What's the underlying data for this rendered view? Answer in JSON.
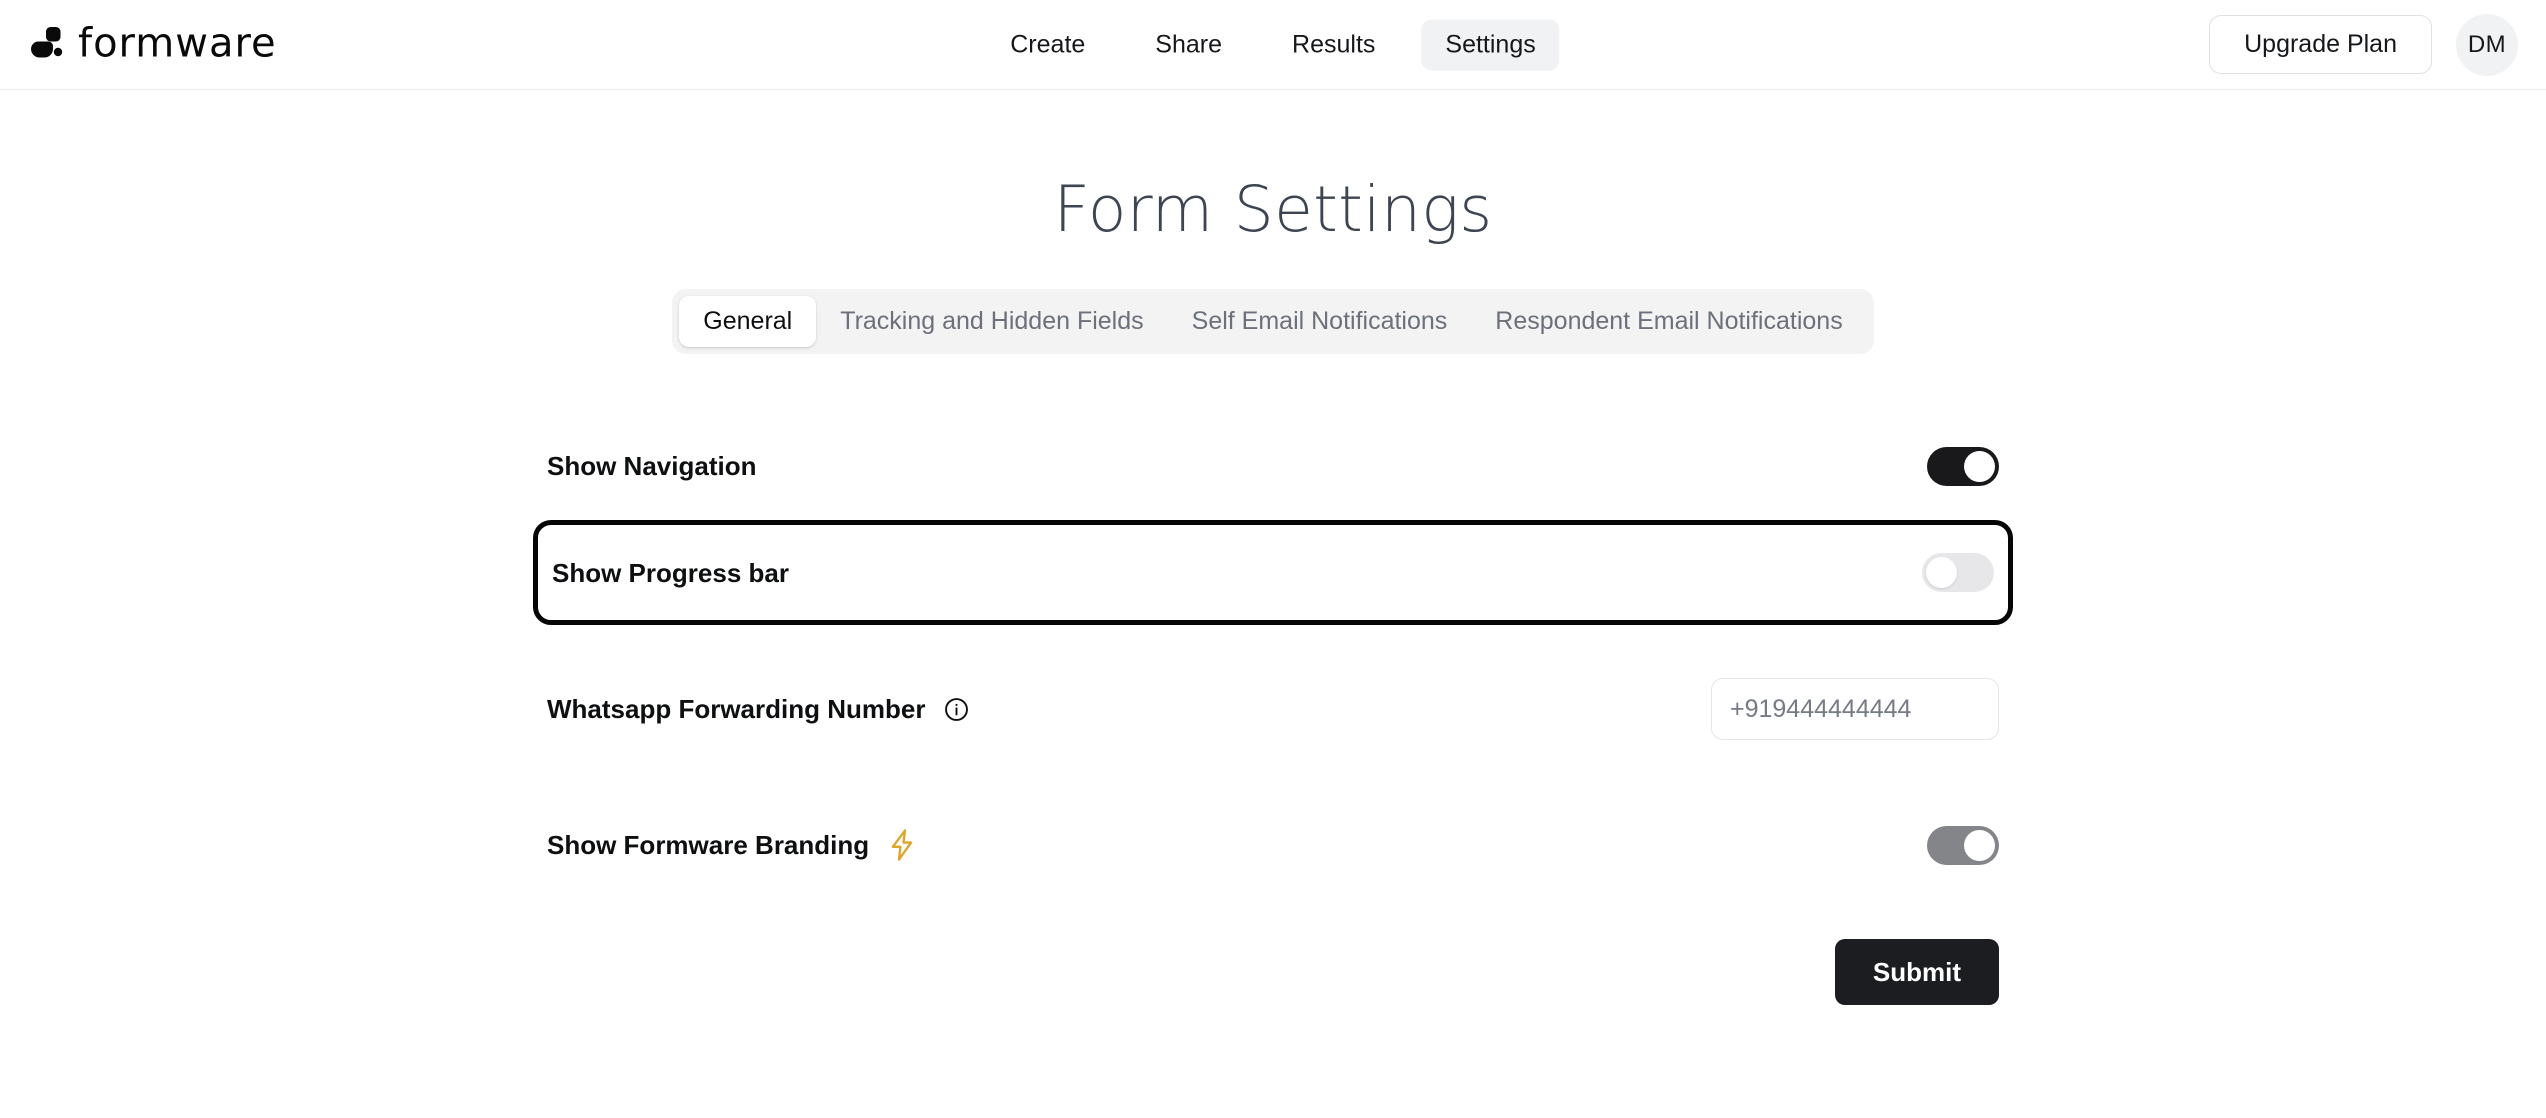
{
  "header": {
    "brand": {
      "word": "formware",
      "mark_icon": "formware-logo-mark"
    },
    "nav": [
      {
        "label": "Create",
        "active": false
      },
      {
        "label": "Share",
        "active": false
      },
      {
        "label": "Results",
        "active": false
      },
      {
        "label": "Settings",
        "active": true
      }
    ],
    "upgrade_label": "Upgrade Plan",
    "avatar_initials": "DM"
  },
  "main": {
    "title": "Form Settings",
    "tabs": [
      {
        "label": "General",
        "active": true
      },
      {
        "label": "Tracking and Hidden Fields",
        "active": false
      },
      {
        "label": "Self Email Notifications",
        "active": false
      },
      {
        "label": "Respondent Email Notifications",
        "active": false
      }
    ],
    "settings": {
      "show_navigation": {
        "label": "Show Navigation",
        "state": "on"
      },
      "show_progress_bar": {
        "label": "Show Progress bar",
        "state": "off",
        "highlighted": true
      },
      "whatsapp": {
        "label": "Whatsapp Forwarding Number",
        "info_icon": "info-circle-icon",
        "value": "",
        "placeholder": "+919444444444"
      },
      "branding": {
        "label": "Show Formware Branding",
        "bolt_icon": "lightning-bolt-icon",
        "state": "on-muted"
      }
    },
    "submit_label": "Submit"
  },
  "colors": {
    "accent_black": "#19191c",
    "toggle_off_track": "#e7e7e9",
    "toggle_muted_track": "#848588",
    "bolt_amber": "#e0a526",
    "title_slate": "#3d4552",
    "tabbar_bg": "#f3f3f4",
    "submit_bg": "#1b1d21"
  }
}
